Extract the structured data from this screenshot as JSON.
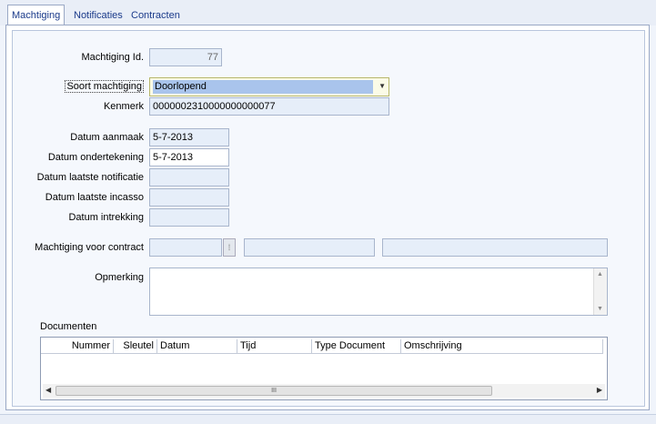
{
  "tabs": [
    {
      "label": "Machtiging"
    },
    {
      "label": "Notificaties"
    },
    {
      "label": "Contracten"
    }
  ],
  "form": {
    "machtiging_id": {
      "label": "Machtiging Id.",
      "value": "77"
    },
    "soort": {
      "label": "Soort machtiging",
      "value": "Doorlopend"
    },
    "kenmerk": {
      "label": "Kenmerk",
      "value": "0000002310000000000077"
    },
    "datum_aanmaak": {
      "label": "Datum aanmaak",
      "value": "5-7-2013"
    },
    "datum_ondertekening": {
      "label": "Datum ondertekening",
      "value": "5-7-2013"
    },
    "datum_laatste_notificatie": {
      "label": "Datum laatste notificatie",
      "value": ""
    },
    "datum_laatste_incasso": {
      "label": "Datum laatste incasso",
      "value": ""
    },
    "datum_intrekking": {
      "label": "Datum intrekking",
      "value": ""
    },
    "contract": {
      "label": "Machtiging voor contract",
      "value1": "",
      "value2": "",
      "value3": ""
    },
    "opmerking": {
      "label": "Opmerking",
      "value": ""
    }
  },
  "documenten": {
    "label": "Documenten",
    "columns": [
      "Nummer",
      "Sleutel",
      "Datum",
      "Tijd",
      "Type Document",
      "Omschrijving"
    ],
    "rows": []
  },
  "scrollbar": {
    "thumb_glyph": "III"
  }
}
